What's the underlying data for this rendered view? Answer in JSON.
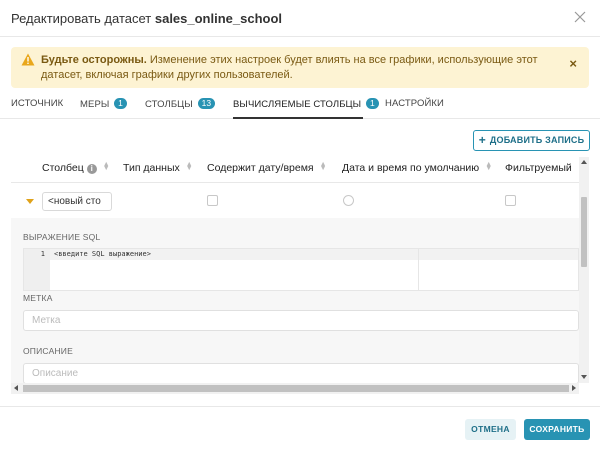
{
  "modal": {
    "title_prefix": "Редактировать датасет",
    "dataset_name": "sales_online_school"
  },
  "alert": {
    "bold": "Будьте осторожны.",
    "text": "Изменение этих настроек будет влиять на все графики, использующие этот датасет, включая графики других пользователей.",
    "close": "×"
  },
  "tabs": [
    {
      "label": "ИСТОЧНИК",
      "badge": ""
    },
    {
      "label": "МЕРЫ",
      "badge": "1"
    },
    {
      "label": "СТОЛБЦЫ",
      "badge": "13"
    },
    {
      "label": "ВЫЧИСЛЯЕМЫЕ СТОЛБЦЫ",
      "badge": "1"
    },
    {
      "label": "НАСТРОЙКИ",
      "badge": ""
    }
  ],
  "active_tab": "ВЫЧИСЛЯЕМЫЕ СТОЛБЦЫ",
  "add_button": {
    "label": "ДОБАВИТЬ ЗАПИСЬ"
  },
  "table": {
    "columns": [
      "Столбец",
      "Тип данных",
      "Содержит дату/время",
      "Дата и время по умолчанию",
      "Фильтруемый"
    ],
    "row": {
      "name_value": "<новый сто"
    }
  },
  "detail": {
    "sql_label": "ВЫРАЖЕНИЕ SQL",
    "sql_line_number": "1",
    "sql_placeholder": "<введите SQL выражение>",
    "label_label": "МЕТКА",
    "label_placeholder": "Метка",
    "description_label": "ОПИСАНИЕ",
    "description_placeholder": "Описание"
  },
  "footer": {
    "cancel": "ОТМЕНА",
    "save": "СОХРАНИТЬ"
  },
  "colors": {
    "accent": "#2893b3",
    "warning_bg": "#fdf3d3",
    "warning_text": "#7a5a13",
    "caret": "#e0a21a"
  }
}
